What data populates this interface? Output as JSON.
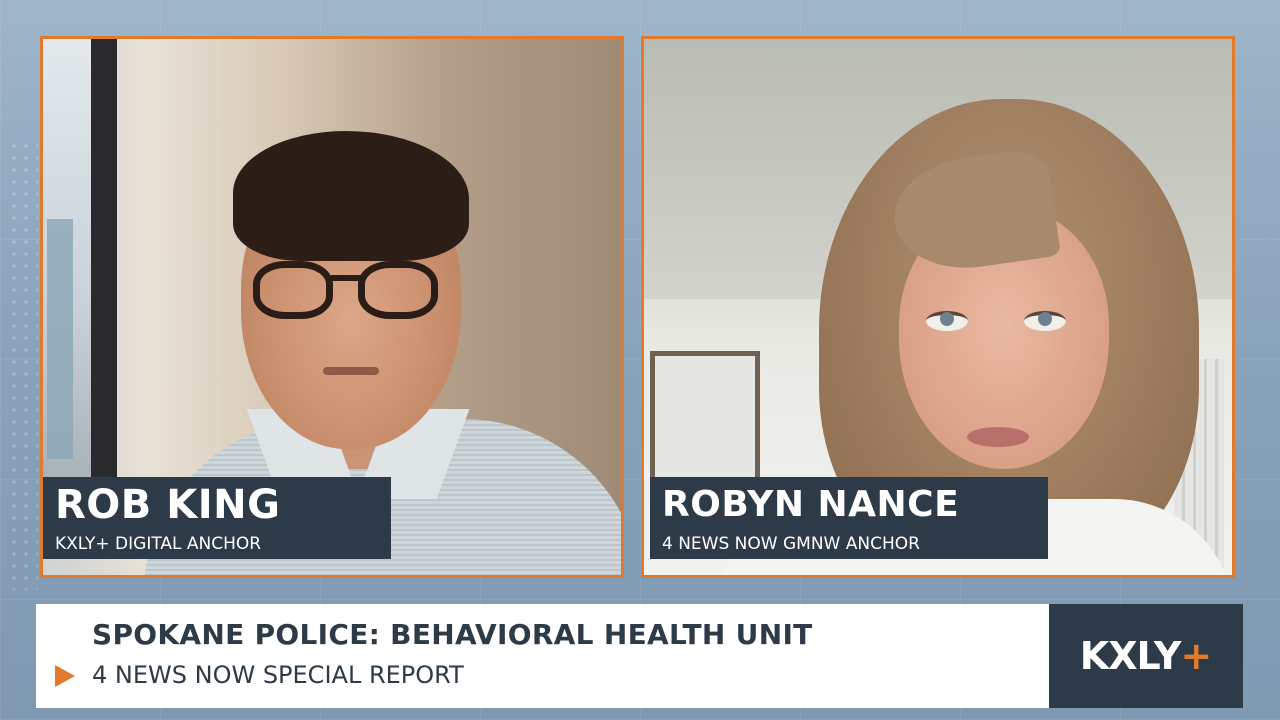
{
  "left_guest": {
    "name": "ROB KING",
    "title": "KXLY+ DIGITAL ANCHOR"
  },
  "right_guest": {
    "name": "ROBYN NANCE",
    "title": "4 NEWS NOW GMNW ANCHOR"
  },
  "lower_third": {
    "headline": "SPOKANE POLICE: BEHAVIORAL HEALTH UNIT",
    "subline": "4 NEWS NOW SPECIAL REPORT",
    "subline_icon": "play-icon"
  },
  "logo": {
    "text": "KXLY",
    "plus": "+"
  },
  "colors": {
    "accent_orange": "#e07b2e",
    "navy": "#2d3a48",
    "background_blue": "#8aa4bc"
  }
}
